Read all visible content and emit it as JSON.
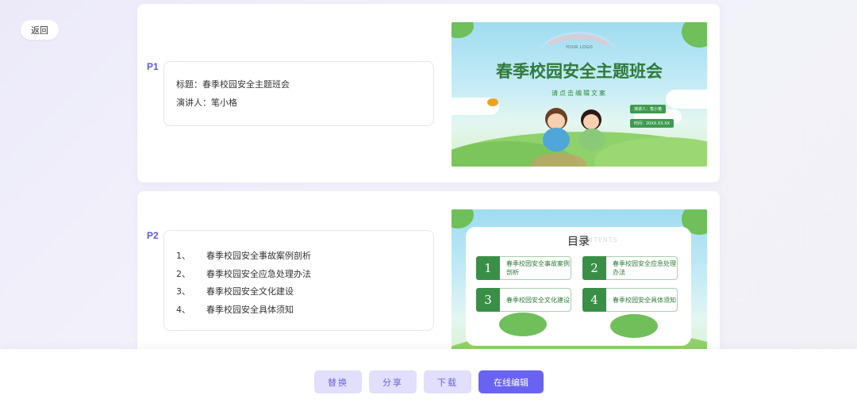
{
  "back_label": "返回",
  "pages": [
    {
      "label": "P1",
      "lines": [
        "标题：春季校园安全主题班会",
        "演讲人：笔小格"
      ],
      "slide": {
        "logo": "YOUR LOGO",
        "title": "春季校园安全主题班会",
        "subtitle": "请点击编辑文案",
        "presenter": "演讲人：笔小格",
        "time": "时间：20XX.XX.XX"
      }
    },
    {
      "label": "P2",
      "items": [
        {
          "num": "1、",
          "text": "春季校园安全事故案例剖析"
        },
        {
          "num": "2、",
          "text": "春季校园安全应急处理办法"
        },
        {
          "num": "3、",
          "text": "春季校园安全文化建设"
        },
        {
          "num": "4、",
          "text": "春季校园安全具体须知"
        }
      ],
      "slide": {
        "heading": "目录",
        "heading_bg": "CONTENTS",
        "toc": [
          {
            "num": "1",
            "text": "春季校园安全事故案例剖析"
          },
          {
            "num": "2",
            "text": "春季校园安全应急处理办法"
          },
          {
            "num": "3",
            "text": "春季校园安全文化建设"
          },
          {
            "num": "4",
            "text": "春季校园安全具体须知"
          }
        ]
      }
    }
  ],
  "actions": {
    "replace": "替换",
    "share": "分享",
    "download": "下载",
    "edit_online": "在线编辑"
  },
  "colors": {
    "accent": "#6a63f2",
    "accent_light": "#e1dffb",
    "label": "#5b5be0",
    "slide_green": "#3a8f47"
  }
}
